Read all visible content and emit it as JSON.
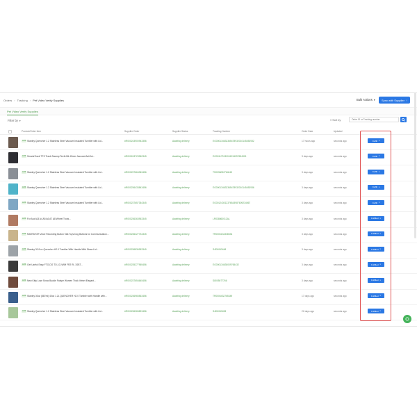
{
  "breadcrumb": [
    "Orders",
    "Tracking",
    "Pet Video Verify Supplies"
  ],
  "header": {
    "bulk_actions": "Bulk Actions",
    "sync_button": "Sync with Supplier"
  },
  "subtab": "Pet Video Verify Supplies",
  "filter": {
    "label": "Filter by",
    "sort": "≡ Sort by",
    "search_placeholder": "Order ID or Tracking number"
  },
  "table": {
    "columns": [
      "Product/Order Item",
      "Supplier Order",
      "Supplier Status",
      "Tracking Number",
      "Order Date",
      "Updated"
    ],
    "rows": [
      {
        "badge": "AUS",
        "product": "Stanley Quencher 1.2 Stainless Steel Vacuum Insulated Tumbler with Lid...",
        "order": "#R000243900943356",
        "status": "Awaiting delivery",
        "tracking": "EG000134632365478932010145453932",
        "created": "17 hours ago",
        "updated": "seconds ago",
        "action": "Fulfill",
        "thumb": "#6b5a4e"
      },
      {
        "badge": "AUS",
        "product": "SmartsTrack TTS Track Swamp Teeth Bit 40mm Jaw and Anti Air...",
        "order": "#R000243723962345",
        "status": "Awaiting delivery",
        "tracking": "EG001173132041234097654321",
        "created": "3 days ago",
        "updated": "seconds ago",
        "action": "Fulfill",
        "thumb": "#2e2e33"
      },
      {
        "badge": "AUS",
        "product": "Stanley Quencher 1.2 Stainless Steel Vacuum Insulated Tumbler with Lid...",
        "order": "#R000237664363456",
        "status": "Awaiting delivery",
        "tracking": "TS0036032764043",
        "created": "3 days ago",
        "updated": "seconds ago",
        "action": "Fulfill",
        "thumb": "#8a8f96"
      },
      {
        "badge": "AUS",
        "product": "Stanley Quencher 1.2 Stainless Steel Vacuum Insulated Tumbler with Lid...",
        "order": "#R000236433843456",
        "status": "Awaiting delivery",
        "tracking": "EG000134632365478932010145453936",
        "created": "3 days ago",
        "updated": "seconds ago",
        "action": "Fulfill",
        "thumb": "#4fb3c9"
      },
      {
        "badge": "AUS",
        "product": "Stanley Quencher 1.2 Stainless Steel Vacuum Insulated Tumbler with Lid...",
        "order": "#R000237657354345",
        "status": "Awaiting delivery",
        "tracking": "EG001243012376543987609234567",
        "created": "3 days ago",
        "updated": "seconds ago",
        "action": "Fulfill",
        "thumb": "#7fa7c4"
      },
      {
        "badge": "AUS",
        "product": "For Audi A3 A4 A5 A6 A7 A8 Wheel Trunk...",
        "order": "#R000236363963345",
        "status": "Awaiting delivery",
        "tracking": "LR038860012AL",
        "created": "3 days ago",
        "updated": "seconds ago",
        "action": "Fulfilled",
        "thumb": "#b07a62"
      },
      {
        "badge": "AUS",
        "product": "MIGRATOR Voice Recording Button Talk Toys Dog Buttons for Communication...",
        "order": "#R000236227734345",
        "status": "Awaiting delivery",
        "tracking": "TR0006134338534",
        "created": "3 days ago",
        "updated": "seconds ago",
        "action": "Fulfilled",
        "thumb": "#c9b48c"
      },
      {
        "badge": "AUS",
        "product": "Stanley 30 fl.oz Quencher H2.0 Tumbler With Handle With Straw Lid...",
        "order": "#R000236836953345",
        "status": "Awaiting delivery",
        "tracking": "S4D0063448",
        "created": "3 days ago",
        "updated": "seconds ago",
        "action": "Fulfilled",
        "thumb": "#9da3a8"
      },
      {
        "badge": "AUS",
        "product": "Get Useful Easy FTG-DG TO-1G-WIM FR2 RL 1SBT...",
        "order": "#R000235277965456",
        "status": "Awaiting delivery",
        "tracking": "EG000134630009765432",
        "created": "3 days ago",
        "updated": "seconds ago",
        "action": "Fulfilled",
        "thumb": "#3b3b3b"
      },
      {
        "badge": "AUS",
        "product": "New Kitty Lose Snow Buckle Fanlpe Women Thick Velvet Elegant...",
        "order": "#R000237654645456",
        "status": "Awaiting delivery",
        "tracking": "S8005077766",
        "created": "3 days ago",
        "updated": "seconds ago",
        "action": "Fulfilled",
        "thumb": "#6f4b3c"
      },
      {
        "badge": "AUS",
        "product": "Stanley 30oz (887ml) 40oz 1.2L QUENCHER H2.0 Tumbler with Handle with...",
        "order": "#R000236965563456",
        "status": "Awaiting delivery",
        "tracking": "TR0006432765349",
        "created": "17 days ago",
        "updated": "seconds ago",
        "action": "Fulfilled",
        "thumb": "#3a5f8c"
      },
      {
        "badge": "AUS",
        "product": "Stanley Quencher 1.2 Stainless Steel Vacuum Insulated Tumbler with Lid...",
        "order": "#R000236365823456",
        "status": "Awaiting delivery",
        "tracking": "S4D0063453",
        "created": "22 days ago",
        "updated": "seconds ago",
        "action": "Fulfilled",
        "thumb": "#a7c79a"
      }
    ]
  },
  "colors": {
    "accent": "#2b78e4",
    "success": "#5aa35a",
    "highlight": "#e05252"
  }
}
